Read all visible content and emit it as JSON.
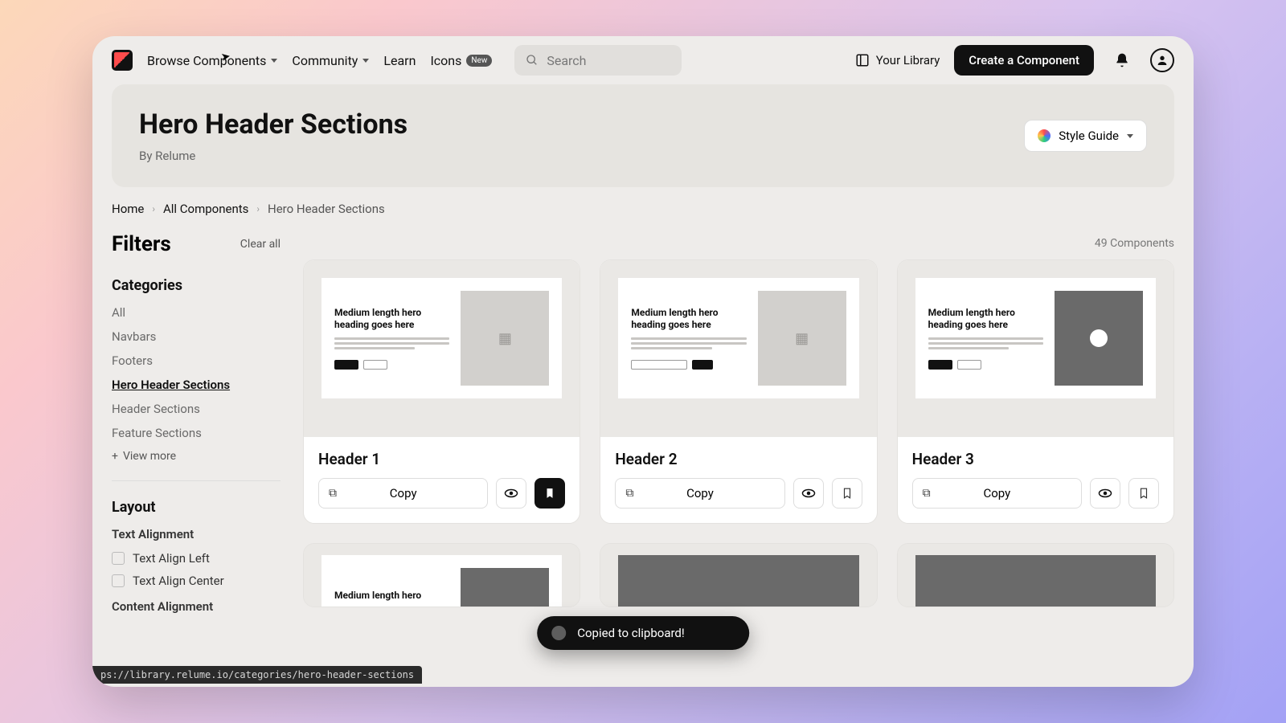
{
  "nav": {
    "browse": "Browse Components",
    "community": "Community",
    "learn": "Learn",
    "icons": "Icons",
    "icons_badge": "New",
    "search_placeholder": "Search",
    "library": "Your Library",
    "create": "Create a Component"
  },
  "banner": {
    "title": "Hero Header Sections",
    "byline": "By Relume",
    "style_btn": "Style Guide"
  },
  "crumbs": {
    "home": "Home",
    "all": "All Components",
    "current": "Hero Header Sections"
  },
  "filters": {
    "title": "Filters",
    "clear": "Clear all",
    "cat_heading": "Categories",
    "cats": [
      "All",
      "Navbars",
      "Footers",
      "Hero Header Sections",
      "Header Sections",
      "Feature Sections"
    ],
    "active_cat": 3,
    "view_more": "View more",
    "layout_heading": "Layout",
    "text_align": "Text Alignment",
    "align_left": "Text Align Left",
    "align_center": "Text Align Center",
    "content_align": "Content Alignment"
  },
  "count": "49 Components",
  "cards": [
    {
      "title": "Header 1",
      "heading": "Medium length hero heading goes here",
      "copy": "Copy",
      "bookmarked": true,
      "variant": "light"
    },
    {
      "title": "Header 2",
      "heading": "Medium length hero heading goes here",
      "copy": "Copy",
      "bookmarked": false,
      "variant": "light-input"
    },
    {
      "title": "Header 3",
      "heading": "Medium length hero heading goes here",
      "copy": "Copy",
      "bookmarked": false,
      "variant": "dark-video"
    }
  ],
  "row2_heading": "Medium length hero",
  "toast": "Copied to clipboard!",
  "url": "ps://library.relume.io/categories/hero-header-sections"
}
